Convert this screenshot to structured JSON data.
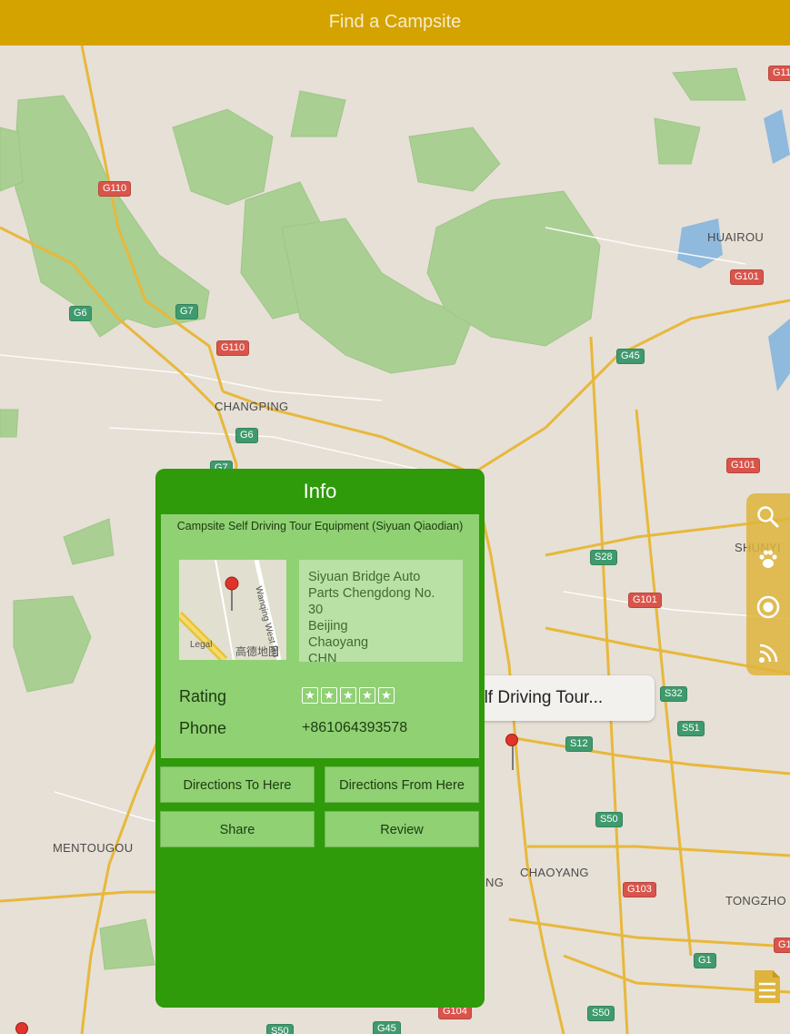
{
  "header": {
    "title": "Find a Campsite"
  },
  "map": {
    "cities": [
      "HUAIROU",
      "CHANGPING",
      "SHUNYI",
      "MENTOUGOU",
      "CHAOYANG",
      "TONGZHO",
      "NG"
    ],
    "road_shields": {
      "red": [
        "G110",
        "G110",
        "G101",
        "G101",
        "G101",
        "G103",
        "G104",
        "G11",
        "G1"
      ],
      "green": [
        "G6",
        "G7",
        "G6",
        "G7",
        "G45",
        "S28",
        "S32",
        "S51",
        "S12",
        "S50",
        "S50",
        "S50",
        "G1",
        "G45"
      ]
    },
    "callout": {
      "text": "elf Driving Tour..."
    }
  },
  "toolbar": {
    "icons": [
      "search-icon",
      "paw-icon",
      "target-icon",
      "rss-icon"
    ]
  },
  "info": {
    "title": "Info",
    "campsite_name": "Campsite Self Driving Tour Equipment (Siyuan Qiaodian)",
    "thumbnail": {
      "road_label": "Wanqing West Ro",
      "legal": "Legal",
      "provider": "高德地图"
    },
    "address_lines": [
      "Siyuan Bridge Auto",
      "Parts Chengdong No.",
      "30",
      "Beijing",
      "Chaoyang",
      "CHN"
    ],
    "rating_label": "Rating",
    "rating_stars": 5,
    "phone_label": "Phone",
    "phone": "+861064393578",
    "buttons": {
      "directions_to": "Directions To Here",
      "directions_from": "Directions From Here",
      "share": "Share",
      "review": "Review"
    }
  },
  "colors": {
    "header": "#d4a300",
    "panel": "#2f9a0a",
    "card": "#8fd173",
    "toolbar": "#deb43c"
  }
}
